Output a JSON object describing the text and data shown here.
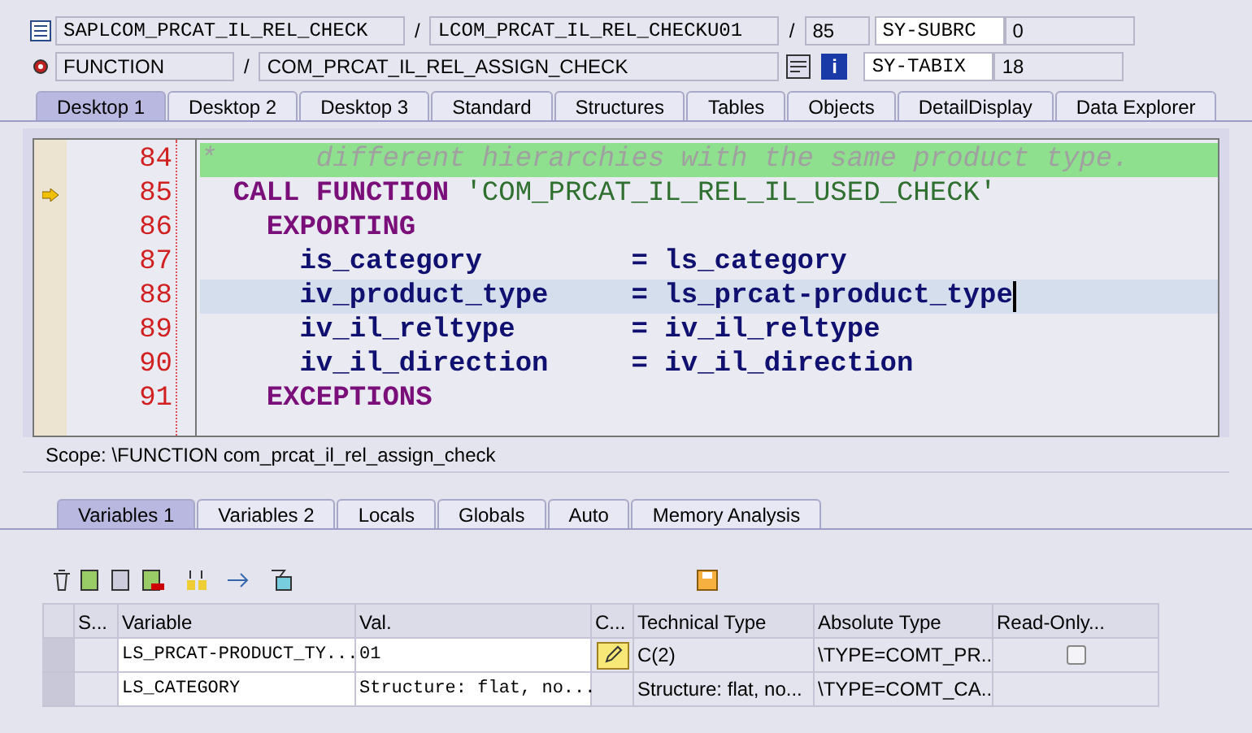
{
  "header": {
    "row1": {
      "program": "SAPLCOM_PRCAT_IL_REL_CHECK",
      "include": "LCOM_PRCAT_IL_REL_CHECKU01",
      "line": "85",
      "sysfield": "SY-SUBRC",
      "sysvalue": "0"
    },
    "row2": {
      "type": "FUNCTION",
      "name": "COM_PRCAT_IL_REL_ASSIGN_CHECK",
      "sysfield": "SY-TABIX",
      "sysvalue": "18"
    },
    "separators": [
      "/",
      "/",
      "/"
    ],
    "info_label": "i"
  },
  "desktop_tabs": [
    {
      "label": "Desktop 1",
      "selected": true
    },
    {
      "label": "Desktop 2",
      "selected": false
    },
    {
      "label": "Desktop 3",
      "selected": false
    },
    {
      "label": "Standard",
      "selected": false
    },
    {
      "label": "Structures",
      "selected": false
    },
    {
      "label": "Tables",
      "selected": false
    },
    {
      "label": "Objects",
      "selected": false
    },
    {
      "label": "DetailDisplay",
      "selected": false
    },
    {
      "label": "Data Explorer",
      "selected": false
    }
  ],
  "code": [
    {
      "number": "84",
      "current": false,
      "cursor": false,
      "kind": "comment",
      "tokens": [
        {
          "kind": "comment",
          "text": "*      different hierarchies with the same product type."
        }
      ]
    },
    {
      "number": "85",
      "current": true,
      "cursor": false,
      "kind": "call",
      "tokens": [
        {
          "kind": "keyword",
          "text": "CALL FUNCTION "
        },
        {
          "kind": "string",
          "text": "'COM_PRCAT_IL_REL_IL_USED_CHECK'"
        }
      ]
    },
    {
      "number": "86",
      "current": false,
      "cursor": false,
      "kind": "section",
      "tokens": [
        {
          "kind": "keyword",
          "text": "EXPORTING"
        }
      ]
    },
    {
      "number": "87",
      "current": false,
      "cursor": false,
      "kind": "parameter",
      "tokens": [
        {
          "kind": "name",
          "text": "is_category         = ls_category"
        }
      ]
    },
    {
      "number": "88",
      "current": false,
      "cursor": true,
      "kind": "parameter",
      "tokens": [
        {
          "kind": "name",
          "text": "iv_product_type     = ls_prcat-product_type"
        }
      ]
    },
    {
      "number": "89",
      "current": false,
      "cursor": false,
      "kind": "parameter",
      "tokens": [
        {
          "kind": "name",
          "text": "iv_il_reltype       = iv_il_reltype"
        }
      ]
    },
    {
      "number": "90",
      "current": false,
      "cursor": false,
      "kind": "parameter",
      "tokens": [
        {
          "kind": "name",
          "text": "iv_il_direction     = iv_il_direction"
        }
      ]
    },
    {
      "number": "91",
      "current": false,
      "cursor": false,
      "kind": "section",
      "tokens": [
        {
          "kind": "keyword",
          "text": "EXCEPTIONS"
        }
      ]
    }
  ],
  "scope": "Scope: \\FUNCTION com_prcat_il_rel_assign_check",
  "variable_tabs": [
    {
      "label": "Variables 1",
      "selected": true
    },
    {
      "label": "Variables 2",
      "selected": false
    },
    {
      "label": "Locals",
      "selected": false
    },
    {
      "label": "Globals",
      "selected": false
    },
    {
      "label": "Auto",
      "selected": false
    },
    {
      "label": "Memory Analysis",
      "selected": false
    }
  ],
  "table": {
    "columns": [
      "S...",
      "Variable",
      "Val.",
      "C...",
      "Technical Type",
      "Absolute Type",
      "Read-Only..."
    ],
    "rows": [
      {
        "variable": "LS_PRCAT-PRODUCT_TY...",
        "value": "01",
        "editable": true,
        "technical_type": "C(2)",
        "absolute_type": "\\TYPE=COMT_PR...",
        "read_only": false
      },
      {
        "variable": "LS_CATEGORY",
        "value": "Structure: flat, no...",
        "editable": false,
        "technical_type": "Structure: flat, no...",
        "absolute_type": "\\TYPE=COMT_CA..."
      }
    ]
  }
}
